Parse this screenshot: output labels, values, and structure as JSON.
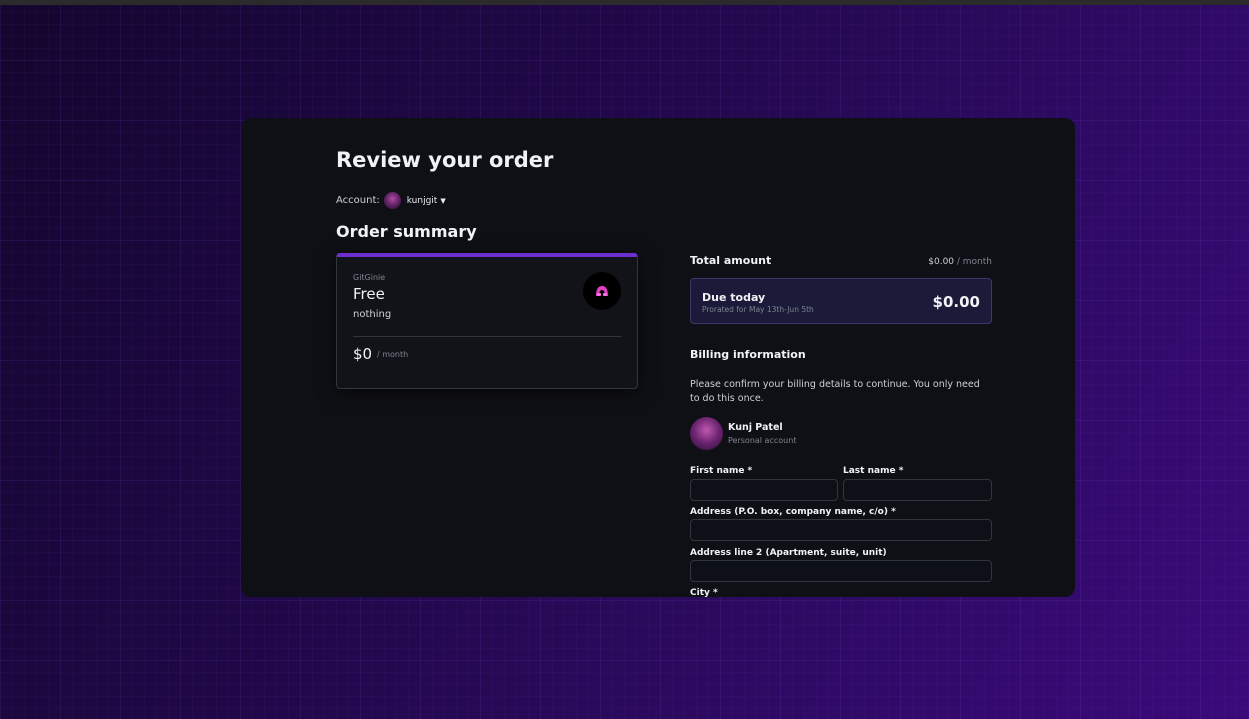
{
  "page": {
    "title": "Review your order"
  },
  "account": {
    "label": "Account:",
    "username": "kunjgit"
  },
  "order_summary": {
    "title": "Order summary",
    "plan": {
      "org": "GitGinie",
      "name": "Free",
      "description": "nothing",
      "price": "$0",
      "period": "/ month"
    }
  },
  "total": {
    "label": "Total amount",
    "value": "$0.00",
    "period": " / month"
  },
  "due_today": {
    "label": "Due today",
    "subtext": "Prorated for May 13th-Jun 5th",
    "amount": "$0.00"
  },
  "billing": {
    "title": "Billing information",
    "description": "Please confirm your billing details to continue. You only need to do this once.",
    "user": {
      "name": "Kunj Patel",
      "type": "Personal account"
    },
    "fields": {
      "first_name": {
        "label": "First name *",
        "value": ""
      },
      "last_name": {
        "label": "Last name *",
        "value": ""
      },
      "address": {
        "label": "Address (P.O. box, company name, c/o) *",
        "value": ""
      },
      "address2": {
        "label": "Address line 2 (Apartment, suite, unit)",
        "value": ""
      },
      "city": {
        "label": "City *"
      }
    }
  },
  "colors": {
    "accent": "#6e2fd0",
    "modal_bg": "#0f1015",
    "due_box_bg": "#1b1a38"
  },
  "icons": {
    "plan_logo": "gitginie-logo-icon",
    "caret": "chevron-down-icon"
  }
}
